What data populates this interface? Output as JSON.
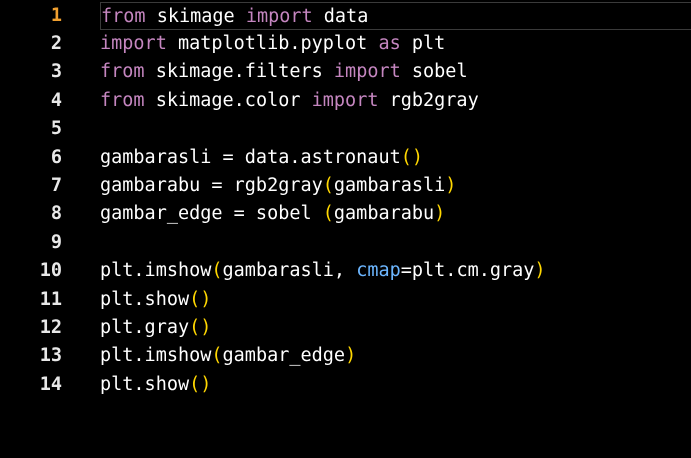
{
  "editor": {
    "current_line": 1,
    "colors": {
      "keyword": "#c586c0",
      "plain": "#ffffff",
      "paren": "#ffd700",
      "param": "#6cb6ff",
      "line_number": "#e8e8e8",
      "current_line_number": "#f0a030",
      "background": "#000000"
    },
    "lines": [
      {
        "number": "1",
        "tokens": [
          {
            "t": "keyword",
            "v": "from"
          },
          {
            "t": "plain",
            "v": " skimage "
          },
          {
            "t": "keyword",
            "v": "import"
          },
          {
            "t": "plain",
            "v": " data"
          }
        ]
      },
      {
        "number": "2",
        "tokens": [
          {
            "t": "keyword",
            "v": "import"
          },
          {
            "t": "plain",
            "v": " matplotlib.pyplot "
          },
          {
            "t": "keyword",
            "v": "as"
          },
          {
            "t": "plain",
            "v": " plt"
          }
        ]
      },
      {
        "number": "3",
        "tokens": [
          {
            "t": "keyword",
            "v": "from"
          },
          {
            "t": "plain",
            "v": " skimage.filters "
          },
          {
            "t": "keyword",
            "v": "import"
          },
          {
            "t": "plain",
            "v": " sobel"
          }
        ]
      },
      {
        "number": "4",
        "tokens": [
          {
            "t": "keyword",
            "v": "from"
          },
          {
            "t": "plain",
            "v": " skimage.color "
          },
          {
            "t": "keyword",
            "v": "import"
          },
          {
            "t": "plain",
            "v": " rgb2gray"
          }
        ]
      },
      {
        "number": "5",
        "tokens": []
      },
      {
        "number": "6",
        "tokens": [
          {
            "t": "plain",
            "v": "gambarasli = data.astronaut"
          },
          {
            "t": "paren",
            "v": "()"
          }
        ]
      },
      {
        "number": "7",
        "tokens": [
          {
            "t": "plain",
            "v": "gambarabu = rgb2gray"
          },
          {
            "t": "paren",
            "v": "("
          },
          {
            "t": "plain",
            "v": "gambarasli"
          },
          {
            "t": "paren",
            "v": ")"
          }
        ]
      },
      {
        "number": "8",
        "tokens": [
          {
            "t": "plain",
            "v": "gambar_edge = sobel "
          },
          {
            "t": "paren",
            "v": "("
          },
          {
            "t": "plain",
            "v": "gambarabu"
          },
          {
            "t": "paren",
            "v": ")"
          }
        ]
      },
      {
        "number": "9",
        "tokens": []
      },
      {
        "number": "10",
        "tokens": [
          {
            "t": "plain",
            "v": "plt.imshow"
          },
          {
            "t": "paren",
            "v": "("
          },
          {
            "t": "plain",
            "v": "gambarasli, "
          },
          {
            "t": "param",
            "v": "cmap"
          },
          {
            "t": "plain",
            "v": "=plt.cm.gray"
          },
          {
            "t": "paren",
            "v": ")"
          }
        ]
      },
      {
        "number": "11",
        "tokens": [
          {
            "t": "plain",
            "v": "plt.show"
          },
          {
            "t": "paren",
            "v": "()"
          }
        ]
      },
      {
        "number": "12",
        "tokens": [
          {
            "t": "plain",
            "v": "plt.gray"
          },
          {
            "t": "paren",
            "v": "()"
          }
        ]
      },
      {
        "number": "13",
        "tokens": [
          {
            "t": "plain",
            "v": "plt.imshow"
          },
          {
            "t": "paren",
            "v": "("
          },
          {
            "t": "plain",
            "v": "gambar_edge"
          },
          {
            "t": "paren",
            "v": ")"
          }
        ]
      },
      {
        "number": "14",
        "tokens": [
          {
            "t": "plain",
            "v": "plt.show"
          },
          {
            "t": "paren",
            "v": "()"
          }
        ]
      }
    ]
  }
}
